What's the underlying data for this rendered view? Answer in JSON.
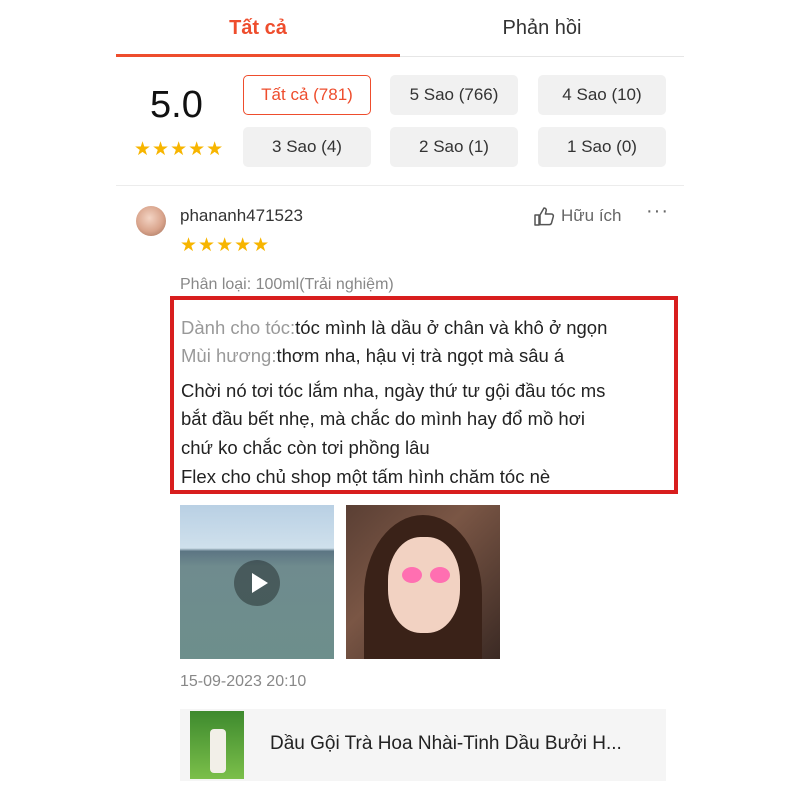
{
  "tabs": {
    "all": "Tất cả",
    "feedback": "Phản hồi"
  },
  "summary": {
    "score": "5.0",
    "stars": "★★★★★"
  },
  "filters": [
    "Tất cả (781)",
    "5 Sao (766)",
    "4 Sao (10)",
    "3 Sao (4)",
    "2 Sao (1)",
    "1 Sao (0)"
  ],
  "review": {
    "username": "phananh471523",
    "stars": "★★★★★",
    "helpful_label": "Hữu ích",
    "more_label": "···",
    "variation": "Phân loại: 100ml(Trải nghiệm)",
    "hair_label": "Dành cho tóc:",
    "hair_value": "tóc mình là dầu ở chân và khô ở ngọn",
    "scent_label": "Mùi hương:",
    "scent_value": "thơm nha, hậu vị trà ngọt mà sâu á",
    "body_lines": [
      "Chời nó tơi tóc lắm nha, ngày thứ tư gội đầu tóc ms",
      "bắt đầu bết nhẹ, mà chắc do mình hay đổ mồ hơi",
      "chứ ko chắc còn tơi phồng lâu",
      "Flex cho chủ shop một tấm hình chăm tóc nè"
    ],
    "date": "15-09-2023 20:10",
    "product_name": "Dầu Gội Trà Hoa Nhài-Tinh Dầu Bưởi H..."
  },
  "colors": {
    "accent": "#ee4d2d",
    "star": "#f7b500",
    "highlight_border": "#d81e1e"
  }
}
